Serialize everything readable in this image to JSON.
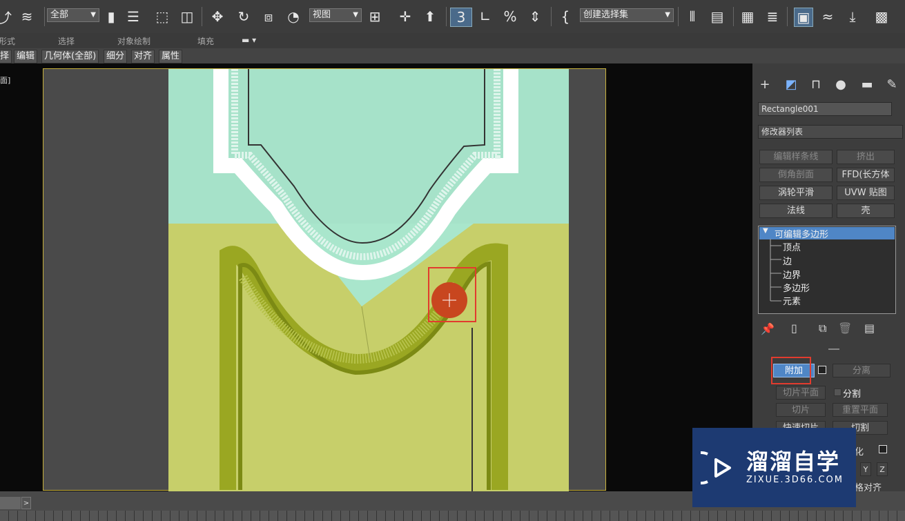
{
  "toolbar": {
    "filter_dropdown": "全部",
    "ref_coord_dropdown": "视图",
    "selection_set_dropdown": "创建选择集"
  },
  "ribbon": {
    "tabs": [
      "形式",
      "选择",
      "对象绘制",
      "填充"
    ],
    "subtabs": [
      "择",
      "编辑",
      "几何体(全部)",
      "细分",
      "对齐",
      "属性"
    ]
  },
  "viewport": {
    "label": "面]"
  },
  "command_panel": {
    "object_name": "Rectangle001",
    "modifier_list": "修改器列表",
    "modifier_buttons": [
      {
        "label": "编辑样条线",
        "dim": true
      },
      {
        "label": "挤出",
        "dim": true
      },
      {
        "label": "倒角剖面",
        "dim": true
      },
      {
        "label": "FFD(长方体",
        "dim": false
      },
      {
        "label": "涡轮平滑",
        "dim": false
      },
      {
        "label": "UVW 贴图",
        "dim": false
      },
      {
        "label": "法线",
        "dim": false
      },
      {
        "label": "壳",
        "dim": false
      }
    ],
    "stack": {
      "root": "可编辑多边形",
      "children": [
        "顶点",
        "边",
        "边界",
        "多边形",
        "元素"
      ]
    },
    "geometry": {
      "attach": "附加",
      "detach": "分离",
      "slice_plane": "切片平面",
      "split": "分割",
      "slice": "切片",
      "reset_plane": "重置平面",
      "quick_slice": "快速切片",
      "cut": "切割",
      "msmooth_partial": "化",
      "axis_y": "Y",
      "axis_z": "Z",
      "align_partial": "格对齐"
    }
  },
  "watermark": {
    "title": "溜溜自学",
    "url": "ZIXUE.3D66.COM"
  },
  "colors": {
    "door_top": "#a9e6cc",
    "door_bottom": "#c7cf6a",
    "frame_border": "#c9b23c",
    "highlight_red": "#e23b2e",
    "stack_selected": "#4f86c6",
    "watermark_bg": "#1d3a72"
  }
}
